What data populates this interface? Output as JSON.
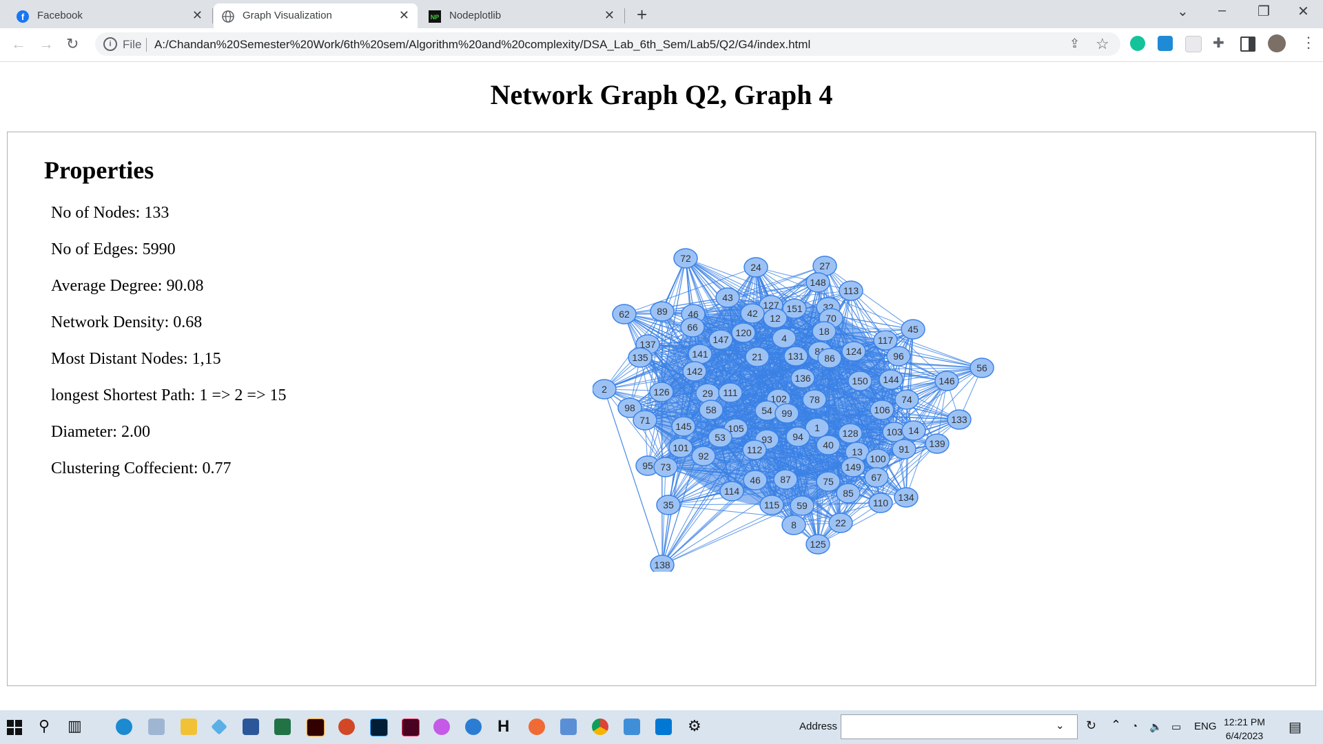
{
  "browser": {
    "tabs": [
      {
        "title": "Facebook",
        "icon": "facebook-icon",
        "color": "#1877f2"
      },
      {
        "title": "Graph Visualization",
        "icon": "globe-icon",
        "color": "#5f6368"
      },
      {
        "title": "Nodeplotlib",
        "icon": "nodeplotlib-icon",
        "color": "#1a8c1a"
      }
    ],
    "address": {
      "scheme_label": "File",
      "url": "A:/Chandan%20Semester%20Work/6th%20sem/Algorithm%20and%20complexity/DSA_Lab_6th_Sem/Lab5/Q2/G4/index.html"
    }
  },
  "page": {
    "title": "Network Graph Q2, Graph 4",
    "properties_heading": "Properties",
    "properties": [
      "No of Nodes: 133",
      "No of Edges: 5990",
      "Average Degree: 90.08",
      "Network Density: 0.68",
      "Most Distant Nodes: 1,15",
      "longest Shortest Path: 1 => 2 => 15",
      "Diameter: 2.00",
      "Clustering Coffecient: 0.77"
    ]
  },
  "graph": {
    "node_color": "#9cc2f5",
    "node_border": "#3b82e6",
    "edge_color": "#3b82e6",
    "node_labels": [
      "72",
      "24",
      "27",
      "148",
      "113",
      "43",
      "89",
      "46",
      "62",
      "66",
      "127",
      "151",
      "32",
      "70",
      "42",
      "12",
      "45",
      "147",
      "120",
      "4",
      "18",
      "137",
      "117",
      "135",
      "141",
      "21",
      "81",
      "124",
      "96",
      "131",
      "86",
      "56",
      "142",
      "136",
      "150",
      "144",
      "146",
      "2",
      "126",
      "29",
      "111",
      "102",
      "78",
      "74",
      "98",
      "58",
      "54",
      "99",
      "106",
      "133",
      "71",
      "145",
      "105",
      "1",
      "128",
      "103",
      "14",
      "53",
      "93",
      "94",
      "40",
      "139",
      "101",
      "92",
      "112",
      "13",
      "100",
      "91",
      "95",
      "73",
      "149",
      "67",
      "114",
      "46b",
      "87",
      "75",
      "85",
      "134",
      "35",
      "115",
      "59",
      "110",
      "8",
      "22",
      "125",
      "138"
    ]
  },
  "taskbar": {
    "address_label": "Address",
    "language": "ENG",
    "time": "12:21 PM",
    "date": "6/4/2023"
  }
}
